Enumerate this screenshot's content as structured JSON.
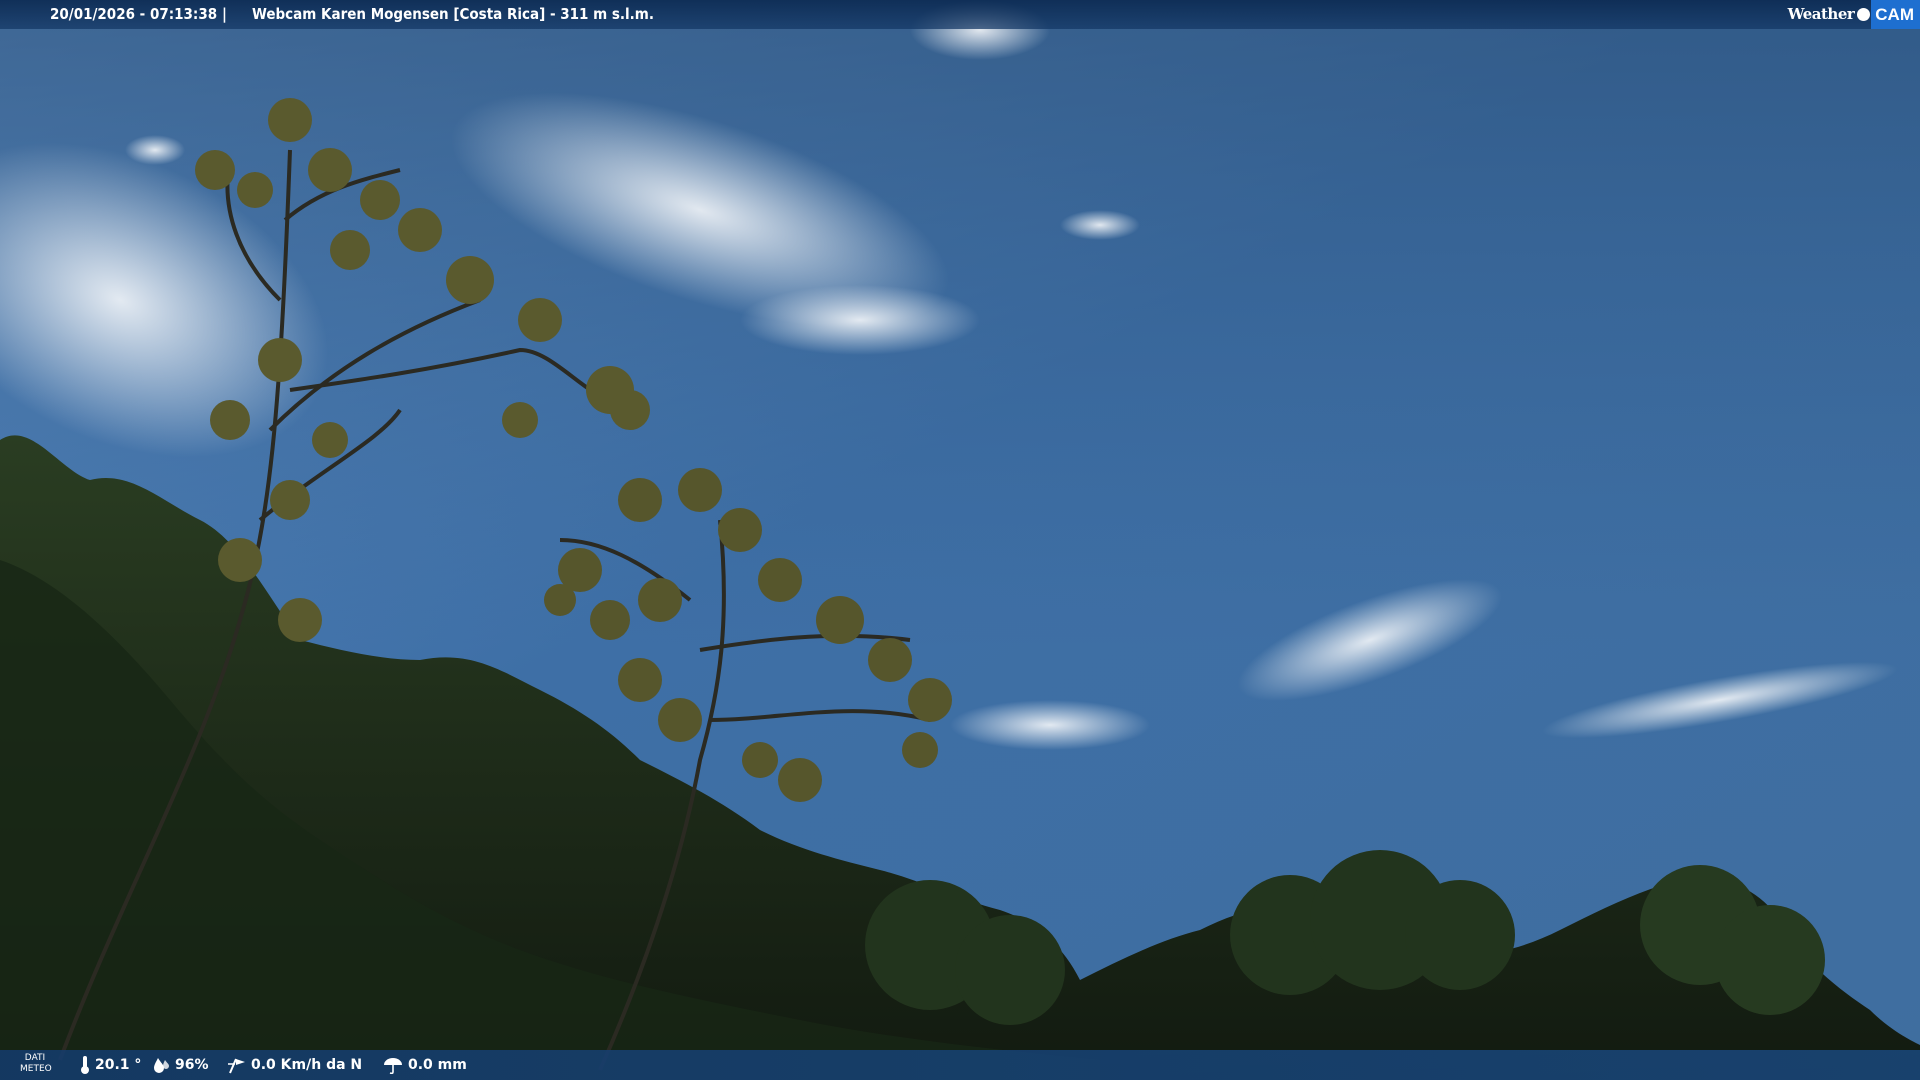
{
  "header": {
    "datetime": "20/01/2026 - 07:13:38",
    "separator": "|",
    "title": "Webcam Karen Mogensen [Costa Rica] - 311 m s.l.m."
  },
  "logo": {
    "word": "Weather",
    "badge": "CAM"
  },
  "weather_bar": {
    "label_line1": "DATI",
    "label_line2": "METEO",
    "temperature": "20.1 °",
    "humidity": "96%",
    "wind": "0.0 Km/h da N",
    "rain": "0.0 mm"
  },
  "colors": {
    "sky_top": "#2a4f7c",
    "sky_bottom": "#4a7fb5",
    "foliage": "#1e2f1a",
    "bar": "#1a4a86",
    "badge": "#1e6fd0"
  }
}
